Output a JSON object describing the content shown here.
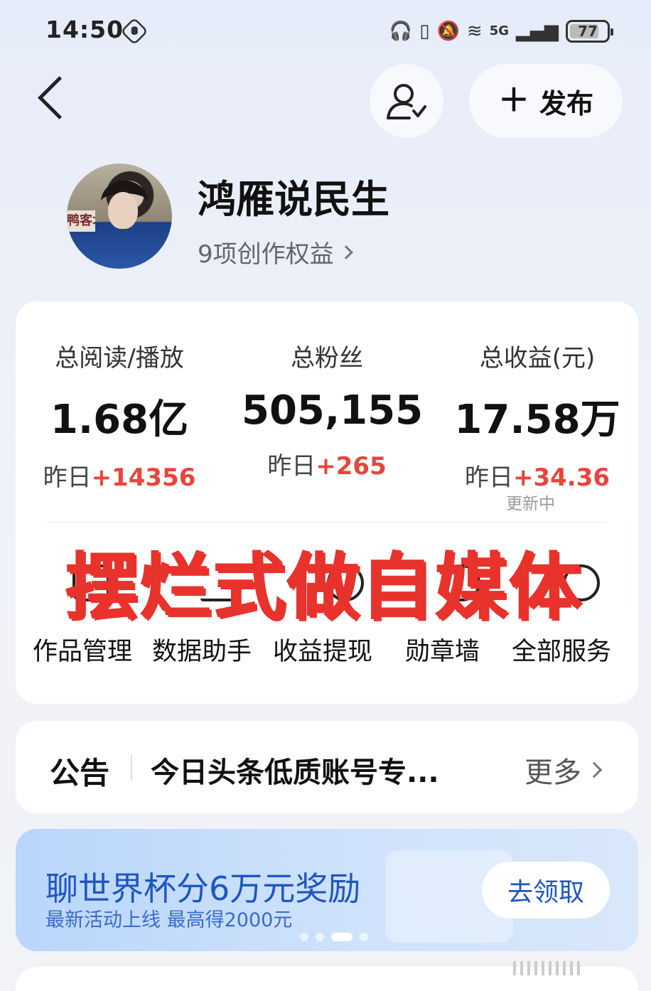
{
  "status_bar": {
    "time": "14:50",
    "network": "5G",
    "battery": "77"
  },
  "header": {
    "publish_label": "发布"
  },
  "profile": {
    "name": "鸿雁说民生",
    "rights": "9项创作权益",
    "avatar_sign_text": "鸭客北"
  },
  "stats": [
    {
      "label": "总阅读/播放",
      "value": "1.68亿",
      "delta_prefix": "昨日",
      "delta": "+14356"
    },
    {
      "label": "总粉丝",
      "value": "505,155",
      "delta_prefix": "昨日",
      "delta": "+265"
    },
    {
      "label": "总收益(元)",
      "value": "17.58万",
      "delta_prefix": "昨日",
      "delta": "+34.36"
    }
  ],
  "stats_status": "更新中",
  "overlay_caption": "摆烂式做自媒体",
  "services": [
    {
      "label": "作品管理",
      "icon": "document-icon"
    },
    {
      "label": "数据助手",
      "icon": "chart-icon"
    },
    {
      "label": "收益提现",
      "icon": "coin-icon"
    },
    {
      "label": "勋章墙",
      "icon": "medal-icon"
    },
    {
      "label": "全部服务",
      "icon": "grid-icon"
    }
  ],
  "notice": {
    "tag": "公告",
    "text": "今日头条低质账号专...",
    "more": "更多"
  },
  "banner": {
    "title": "聊世界杯分6万元奖励",
    "subtitle": "最新活动上线 最高得2000元",
    "button": "去领取",
    "pages": 4,
    "active_page": 3
  },
  "colors": {
    "accent_red": "#e8453c",
    "banner_blue": "#1f56c1",
    "overlay_red": "#e8322c"
  }
}
